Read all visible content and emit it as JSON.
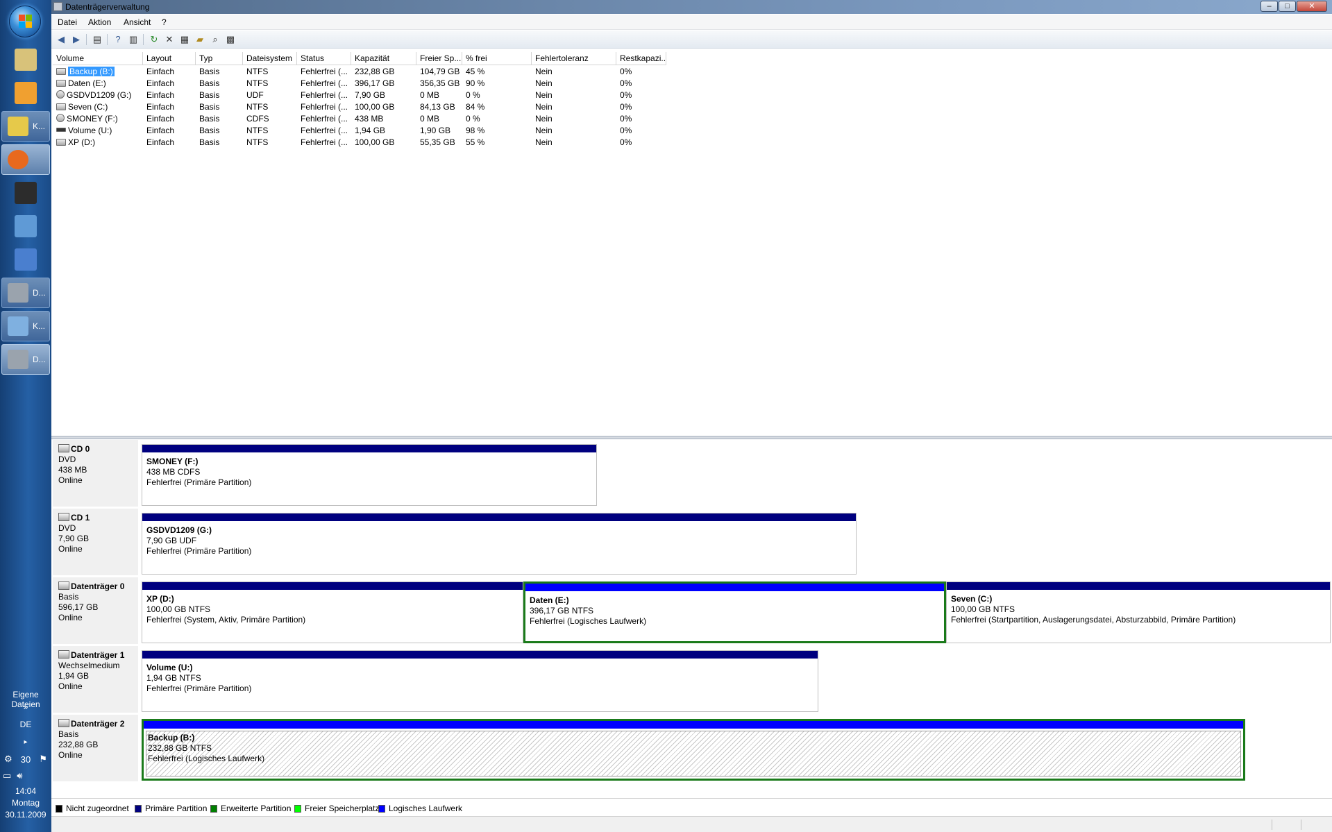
{
  "window": {
    "title": "Datenträgerverwaltung"
  },
  "menu": {
    "items": [
      "Datei",
      "Aktion",
      "Ansicht",
      "?"
    ]
  },
  "toolbar": {
    "icons": [
      "back-icon",
      "forward-icon",
      "show-hide-tree-icon",
      "help-icon",
      "show-hide-action-pane-icon",
      "refresh-icon",
      "delete-icon",
      "properties-icon",
      "open-icon",
      "explore-icon",
      "settings-icon"
    ]
  },
  "volume_table": {
    "columns": [
      "Volume",
      "Layout",
      "Typ",
      "Dateisystem",
      "Status",
      "Kapazität",
      "Freier Sp...",
      "% frei",
      "Fehlertoleranz",
      "Restkapazi..."
    ],
    "rows": [
      {
        "volume": "Backup (B:)",
        "layout": "Einfach",
        "typ": "Basis",
        "fs": "NTFS",
        "status": "Fehlerfrei (...",
        "cap": "232,88 GB",
        "free": "104,79 GB",
        "pct": "45 %",
        "ft": "Nein",
        "rest": "0%",
        "icon": "hdd",
        "selected": true
      },
      {
        "volume": "Daten (E:)",
        "layout": "Einfach",
        "typ": "Basis",
        "fs": "NTFS",
        "status": "Fehlerfrei (...",
        "cap": "396,17 GB",
        "free": "356,35 GB",
        "pct": "90 %",
        "ft": "Nein",
        "rest": "0%",
        "icon": "hdd"
      },
      {
        "volume": "GSDVD1209 (G:)",
        "layout": "Einfach",
        "typ": "Basis",
        "fs": "UDF",
        "status": "Fehlerfrei (...",
        "cap": "7,90 GB",
        "free": "0 MB",
        "pct": "0 %",
        "ft": "Nein",
        "rest": "0%",
        "icon": "cd"
      },
      {
        "volume": "Seven (C:)",
        "layout": "Einfach",
        "typ": "Basis",
        "fs": "NTFS",
        "status": "Fehlerfrei (...",
        "cap": "100,00 GB",
        "free": "84,13 GB",
        "pct": "84 %",
        "ft": "Nein",
        "rest": "0%",
        "icon": "hdd"
      },
      {
        "volume": "SMONEY (F:)",
        "layout": "Einfach",
        "typ": "Basis",
        "fs": "CDFS",
        "status": "Fehlerfrei (...",
        "cap": "438 MB",
        "free": "0 MB",
        "pct": "0 %",
        "ft": "Nein",
        "rest": "0%",
        "icon": "cd"
      },
      {
        "volume": "Volume (U:)",
        "layout": "Einfach",
        "typ": "Basis",
        "fs": "NTFS",
        "status": "Fehlerfrei (...",
        "cap": "1,94 GB",
        "free": "1,90 GB",
        "pct": "98 %",
        "ft": "Nein",
        "rest": "0%",
        "icon": "usb"
      },
      {
        "volume": "XP (D:)",
        "layout": "Einfach",
        "typ": "Basis",
        "fs": "NTFS",
        "status": "Fehlerfrei (...",
        "cap": "100,00 GB",
        "free": "55,35 GB",
        "pct": "55 %",
        "ft": "Nein",
        "rest": "0%",
        "icon": "hdd"
      }
    ]
  },
  "disks": [
    {
      "name": "CD 0",
      "type": "DVD",
      "size": "438 MB",
      "state": "Online",
      "partitions": [
        {
          "name": "SMONEY  (F:)",
          "size": "438 MB CDFS",
          "status": "Fehlerfrei (Primäre Partition)",
          "kind": "primary"
        }
      ]
    },
    {
      "name": "CD 1",
      "type": "DVD",
      "size": "7,90 GB",
      "state": "Online",
      "partitions": [
        {
          "name": "GSDVD1209  (G:)",
          "size": "7,90 GB UDF",
          "status": "Fehlerfrei (Primäre Partition)",
          "kind": "primary"
        }
      ]
    },
    {
      "name": "Datenträger 0",
      "type": "Basis",
      "size": "596,17 GB",
      "state": "Online",
      "partitions": [
        {
          "name": "XP  (D:)",
          "size": "100,00 GB NTFS",
          "status": "Fehlerfrei (System, Aktiv, Primäre Partition)",
          "kind": "primary"
        },
        {
          "name": "Daten  (E:)",
          "size": "396,17 GB NTFS",
          "status": "Fehlerfrei (Logisches Laufwerk)",
          "kind": "logical"
        },
        {
          "name": "Seven  (C:)",
          "size": "100,00 GB NTFS",
          "status": "Fehlerfrei (Startpartition, Auslagerungsdatei, Absturzabbild, Primäre Partition)",
          "kind": "primary"
        }
      ]
    },
    {
      "name": "Datenträger 1",
      "type": "Wechselmedium",
      "size": "1,94 GB",
      "state": "Online",
      "partitions": [
        {
          "name": "Volume  (U:)",
          "size": "1,94 GB NTFS",
          "status": "Fehlerfrei (Primäre Partition)",
          "kind": "primary"
        }
      ]
    },
    {
      "name": "Datenträger 2",
      "type": "Basis",
      "size": "232,88 GB",
      "state": "Online",
      "partitions": [
        {
          "name": "Backup  (B:)",
          "size": "232,88 GB NTFS",
          "status": "Fehlerfrei (Logisches Laufwerk)",
          "kind": "logical"
        }
      ]
    }
  ],
  "legend": [
    {
      "label": "Nicht zugeordnet",
      "color": "#000000"
    },
    {
      "label": "Primäre Partition",
      "color": "#00007f"
    },
    {
      "label": "Erweiterte Partition",
      "color": "#007f00"
    },
    {
      "label": "Freier Speicherplatz",
      "color": "#00ff00"
    },
    {
      "label": "Logisches Laufwerk",
      "color": "#0000ff"
    }
  ],
  "colors": {
    "primary": "#00007f",
    "logical": "#0000ff",
    "extended": "#1a7a1a",
    "selection": "#3399ff"
  },
  "taskbar": {
    "buttons": [
      {
        "icon": "start-orb-icon"
      },
      {
        "icon": "explorer-icon"
      },
      {
        "icon": "media-player-icon"
      },
      {
        "icon": "folder-icon",
        "label": "K..."
      },
      {
        "icon": "firefox-icon"
      },
      {
        "icon": "console-icon"
      },
      {
        "icon": "thunderbird-icon"
      },
      {
        "icon": "stack-icon"
      },
      {
        "icon": "disk-management-icon",
        "label": "D..."
      },
      {
        "icon": "image-icon",
        "label": "K..."
      },
      {
        "icon": "disk-management-icon",
        "label": "D..."
      }
    ],
    "eigene_dateien": "Eigene Dateien",
    "expand": "»",
    "language": "DE",
    "tray_number": "30",
    "time": "14:04",
    "weekday": "Montag",
    "date": "30.11.2009"
  }
}
